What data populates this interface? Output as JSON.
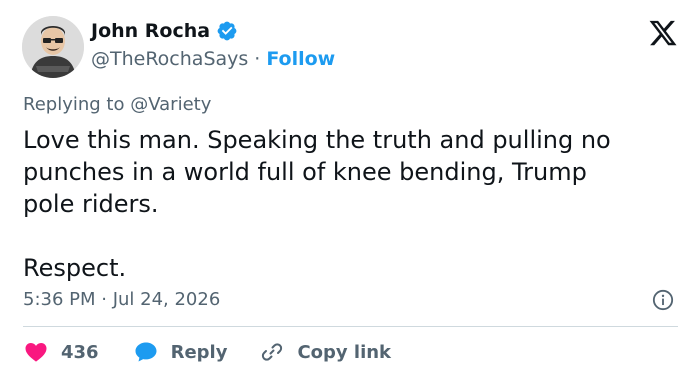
{
  "author": {
    "name": "John Rocha",
    "handle": "@TheRochaSays",
    "separator": "·",
    "follow_label": "Follow"
  },
  "reply_context": {
    "prefix": "Replying to",
    "target": "@Variety"
  },
  "tweet": {
    "text": "Love this man. Speaking the truth and pulling no\npunches in a world full of knee bending, Trump\npole riders.\n\nRespect."
  },
  "meta": {
    "timestamp": "5:36 PM · Jul 24, 2026"
  },
  "actions": {
    "like_count": "436",
    "reply_label": "Reply",
    "copy_label": "Copy link"
  },
  "icons": {
    "verified": "verified-badge-icon",
    "logo": "x-logo-icon",
    "info": "info-icon",
    "like": "heart-icon",
    "reply": "speech-bubble-icon",
    "copy": "link-icon"
  },
  "colors": {
    "accent": "#1d9bf0",
    "like": "#f91880",
    "text": "#0f1419",
    "muted": "#536471"
  }
}
